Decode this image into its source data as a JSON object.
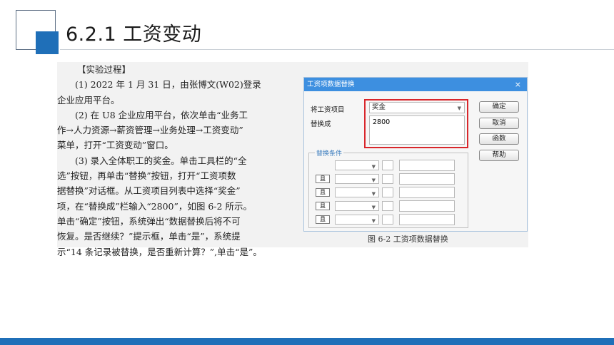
{
  "slide": {
    "title": "6.2.1  工资变动"
  },
  "text": {
    "heading": "【实验过程】",
    "paragraphs": [
      {
        "indent": true,
        "text": "(1) 2022 年 1 月 31 日，由张博文(W02)登录"
      },
      {
        "indent": false,
        "text": "企业应用平台。"
      },
      {
        "indent": true,
        "text": "(2) 在 U8 企业应用平台，依次单击“业务工"
      },
      {
        "indent": false,
        "text": "作→人力资源→薪资管理→业务处理→工资变动”"
      },
      {
        "indent": false,
        "text": "菜单，打开“工资变动”窗口。"
      },
      {
        "indent": true,
        "text": "(3) 录入全体职工的奖金。单击工具栏的“全"
      },
      {
        "indent": false,
        "text": "选”按钮，再单击“替换”按钮，打开“工资项数"
      },
      {
        "indent": false,
        "text": "据替换”对话框。从工资项目列表中选择“奖金”"
      },
      {
        "indent": false,
        "text": "项，在“替换成”栏输入“2800”，如图 6-2 所示。"
      },
      {
        "indent": false,
        "text": "单击“确定”按钮，系统弹出“数据替换后将不可"
      },
      {
        "indent": false,
        "text": "恢复。是否继续？”提示框，单击“是”，系统提"
      },
      {
        "indent": false,
        "text": "示“14 条记录被替换，是否重新计算？”,单击“是”。"
      }
    ]
  },
  "dialog": {
    "title": "工资项数据替换",
    "close": "×",
    "item_label": "将工资项目",
    "item_value": "奖金",
    "replace_label": "替换成",
    "replace_value": "2800",
    "buttons": {
      "ok": "确定",
      "cancel": "取消",
      "function": "函数",
      "help": "帮助"
    },
    "conditions_title": "替换条件",
    "and_label": "且",
    "caret": "▼"
  },
  "caption": "图 6-2  工资项数据替换",
  "colors": {
    "accent": "#1f6fb8",
    "dialog_title": "#3d8fe0",
    "highlight": "#d9262b"
  }
}
